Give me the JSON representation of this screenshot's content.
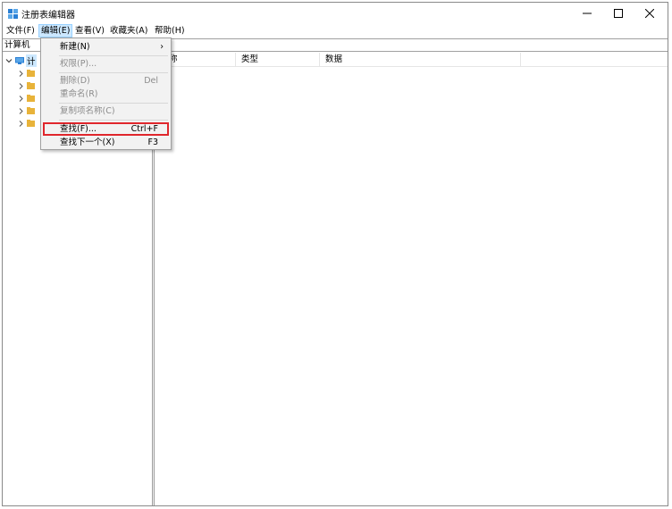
{
  "window": {
    "title": "注册表编辑器",
    "controls": {
      "minimize": "—",
      "maximize": "☐",
      "close": "✕"
    },
    "icon": "registry-editor-icon"
  },
  "menubar": {
    "items": [
      {
        "label": "文件(F)"
      },
      {
        "label": "编辑(E)"
      },
      {
        "label": "查看(V)"
      },
      {
        "label": "收藏夹(A)"
      },
      {
        "label": "帮助(H)"
      }
    ]
  },
  "addressbar": {
    "value": "计算机"
  },
  "tree": {
    "root_label": "计",
    "root_icon": "computer-icon",
    "child_icon": "folder-icon"
  },
  "list": {
    "columns": [
      {
        "label": "称"
      },
      {
        "label": "类型"
      },
      {
        "label": "数据"
      }
    ]
  },
  "edit_menu": {
    "items": [
      {
        "label": "新建(N)",
        "shortcut": "",
        "submenu_arrow": "›"
      },
      {
        "label": "权限(P)...",
        "shortcut": ""
      },
      {
        "label": "删除(D)",
        "shortcut": "Del"
      },
      {
        "label": "重命名(R)",
        "shortcut": ""
      },
      {
        "label": "复制项名称(C)",
        "shortcut": ""
      },
      {
        "label": "查找(F)...",
        "shortcut": "Ctrl+F"
      },
      {
        "label": "查找下一个(X)",
        "shortcut": "F3"
      }
    ],
    "highlight_color": "#e0262c"
  },
  "colors": {
    "menu_active_bg": "#cce8ff",
    "menu_bg": "#f2f2f2",
    "disabled_text": "#8c8c8c",
    "folder": "#e8b33a",
    "accent_blue": "#2a7fd4"
  }
}
